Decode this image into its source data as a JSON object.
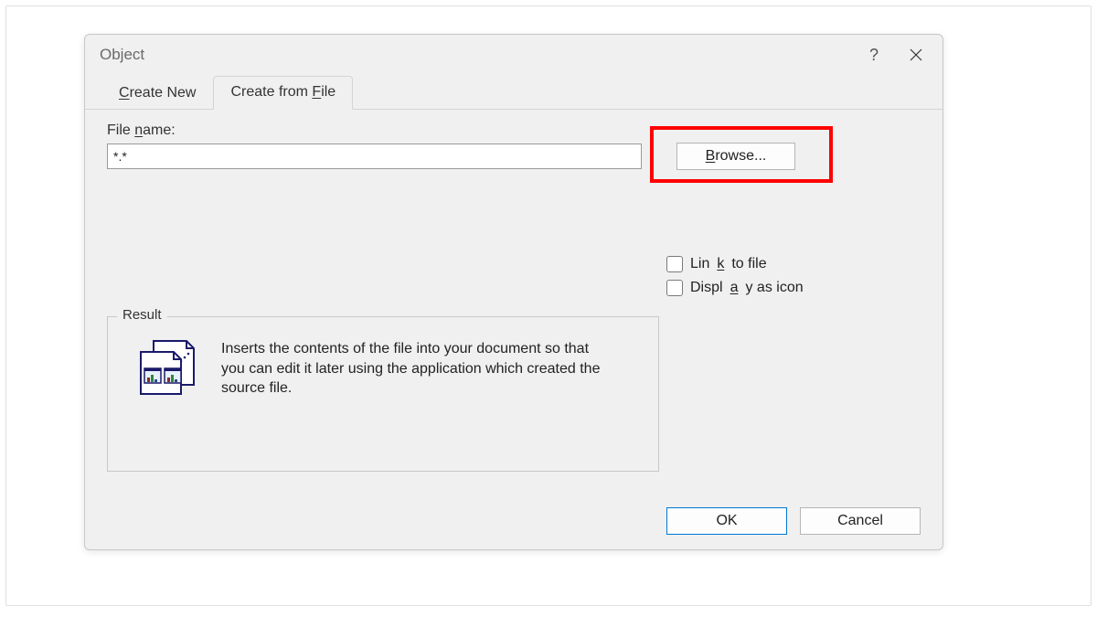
{
  "dialog": {
    "title": "Object",
    "tabs": {
      "create_new": "Create New",
      "create_from_file": "Create from File"
    },
    "filename_label": "File name:",
    "filename_value": "*.*",
    "browse_label": "Browse...",
    "checkboxes": {
      "link_to_file": "Link to file",
      "display_as_icon": "Display as icon"
    },
    "result": {
      "legend": "Result",
      "text": "Inserts the contents of the file into your document so that you can edit it later using the application which created the source file."
    },
    "buttons": {
      "ok": "OK",
      "cancel": "Cancel"
    }
  },
  "access_keys": {
    "create_new": "C",
    "create_from_file_letter": "F",
    "filename_letter": "n",
    "browse_letter": "B",
    "link_letter": "k",
    "display_letter": "a"
  }
}
